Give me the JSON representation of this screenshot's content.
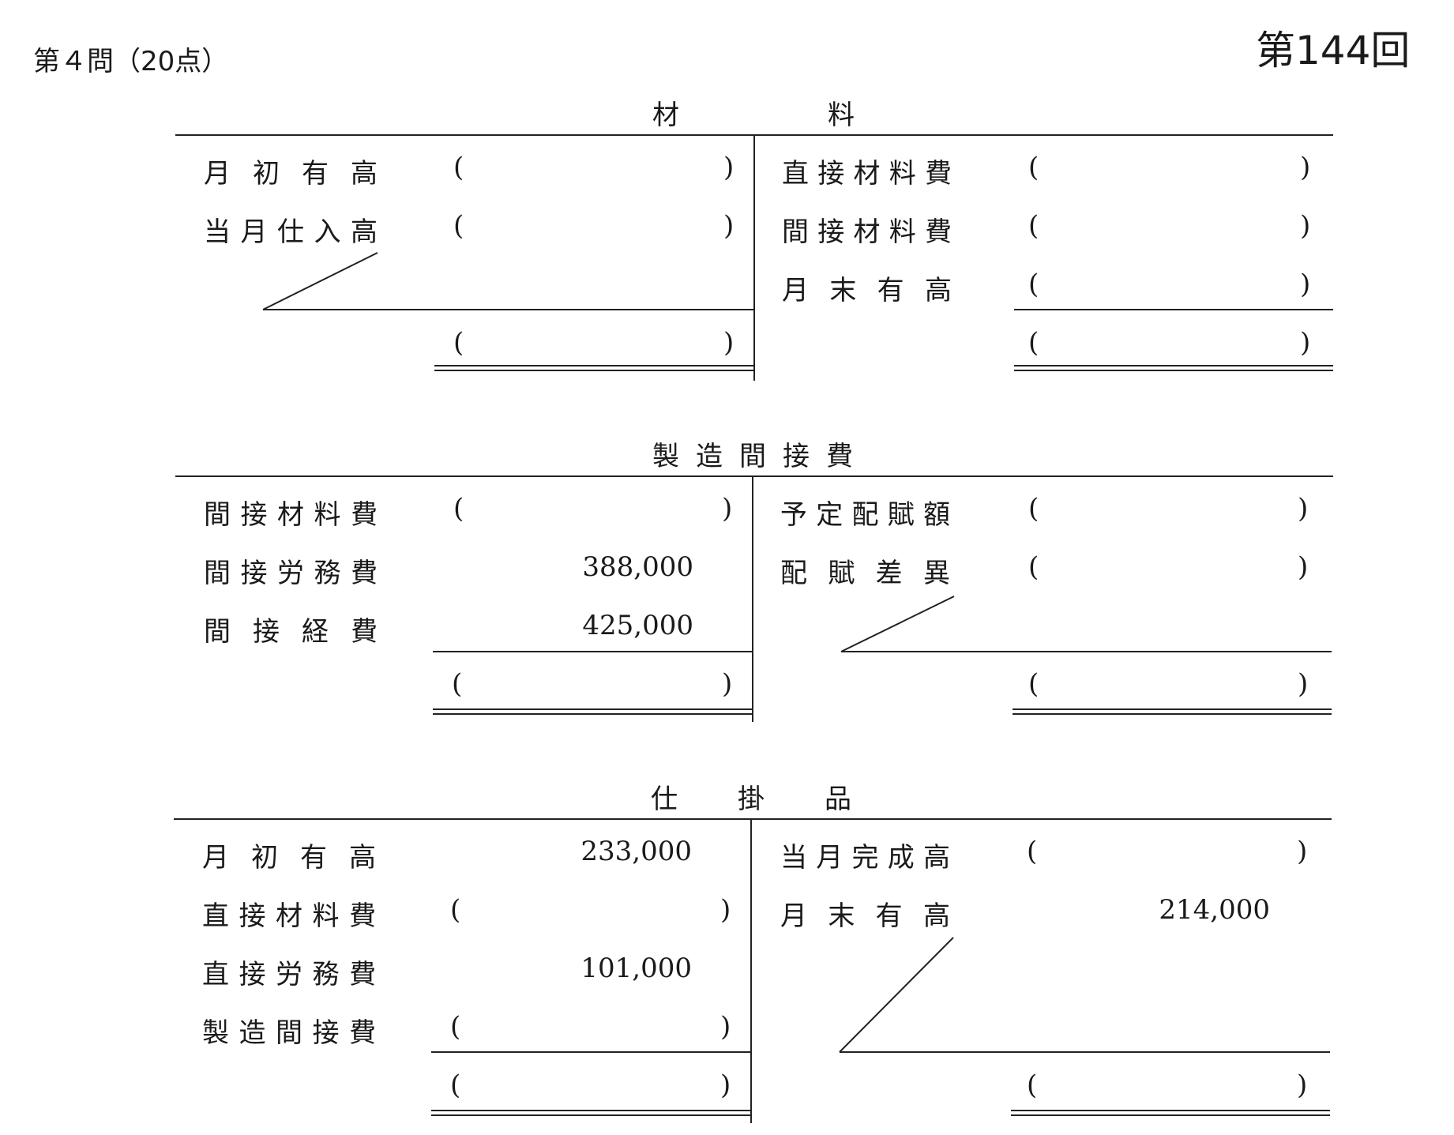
{
  "header": {
    "question": "第４問（20点）",
    "edition": "第144回"
  },
  "accounts": [
    {
      "title": "材料",
      "title_chars": [
        "材",
        "料"
      ],
      "debit": [
        {
          "label": "月初有高",
          "value": null
        },
        {
          "label": "当月仕入高",
          "value": null
        }
      ],
      "credit": [
        {
          "label": "直接材料費",
          "value": null
        },
        {
          "label": "間接材料費",
          "value": null
        },
        {
          "label": "月末有高",
          "value": null
        }
      ]
    },
    {
      "title": "製造間接費",
      "title_chars": [
        "製",
        "造",
        "間",
        "接",
        "費"
      ],
      "debit": [
        {
          "label": "間接材料費",
          "value": null
        },
        {
          "label": "間接労務費",
          "value": "388,000"
        },
        {
          "label": "間接経費",
          "value": "425,000"
        }
      ],
      "credit": [
        {
          "label": "予定配賦額",
          "value": null
        },
        {
          "label": "配賦差異",
          "value": null
        }
      ]
    },
    {
      "title": "仕掛品",
      "title_chars": [
        "仕",
        "掛",
        "品"
      ],
      "debit": [
        {
          "label": "月初有高",
          "value": "233,000"
        },
        {
          "label": "直接材料費",
          "value": null
        },
        {
          "label": "直接労務費",
          "value": "101,000"
        },
        {
          "label": "製造間接費",
          "value": null
        }
      ],
      "credit": [
        {
          "label": "当月完成高",
          "value": null
        },
        {
          "label": "月末有高",
          "value": "214,000"
        }
      ]
    }
  ],
  "blank": {
    "open": "(",
    "close": ")"
  }
}
